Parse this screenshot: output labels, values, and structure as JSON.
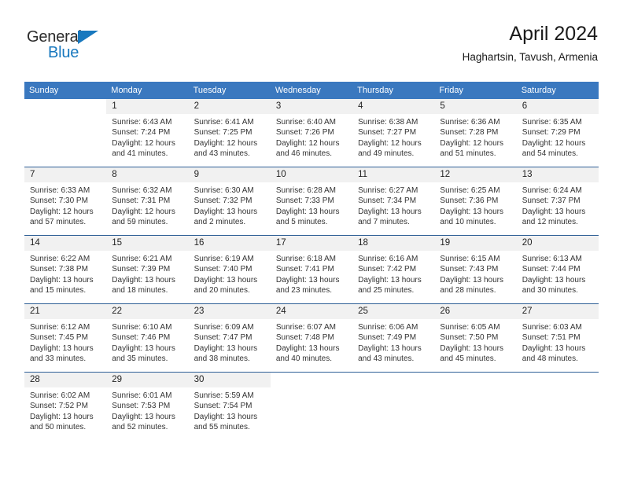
{
  "brand": {
    "name_top": "General",
    "name_bottom": "Blue",
    "flag_color": "#1878be"
  },
  "header": {
    "title": "April 2024",
    "subtitle": "Haghartsin, Tavush, Armenia"
  },
  "theme": {
    "header_row_bg": "#3a78bf",
    "header_row_text": "#ffffff",
    "daynum_bg": "#f1f1f1",
    "row_divider": "#2e5f96"
  },
  "columns": [
    "Sunday",
    "Monday",
    "Tuesday",
    "Wednesday",
    "Thursday",
    "Friday",
    "Saturday"
  ],
  "weeks": [
    [
      {
        "day": "",
        "sunrise": "",
        "sunset": "",
        "daylight_line1": "",
        "daylight_line2": ""
      },
      {
        "day": "1",
        "sunrise": "Sunrise: 6:43 AM",
        "sunset": "Sunset: 7:24 PM",
        "daylight_line1": "Daylight: 12 hours",
        "daylight_line2": "and 41 minutes."
      },
      {
        "day": "2",
        "sunrise": "Sunrise: 6:41 AM",
        "sunset": "Sunset: 7:25 PM",
        "daylight_line1": "Daylight: 12 hours",
        "daylight_line2": "and 43 minutes."
      },
      {
        "day": "3",
        "sunrise": "Sunrise: 6:40 AM",
        "sunset": "Sunset: 7:26 PM",
        "daylight_line1": "Daylight: 12 hours",
        "daylight_line2": "and 46 minutes."
      },
      {
        "day": "4",
        "sunrise": "Sunrise: 6:38 AM",
        "sunset": "Sunset: 7:27 PM",
        "daylight_line1": "Daylight: 12 hours",
        "daylight_line2": "and 49 minutes."
      },
      {
        "day": "5",
        "sunrise": "Sunrise: 6:36 AM",
        "sunset": "Sunset: 7:28 PM",
        "daylight_line1": "Daylight: 12 hours",
        "daylight_line2": "and 51 minutes."
      },
      {
        "day": "6",
        "sunrise": "Sunrise: 6:35 AM",
        "sunset": "Sunset: 7:29 PM",
        "daylight_line1": "Daylight: 12 hours",
        "daylight_line2": "and 54 minutes."
      }
    ],
    [
      {
        "day": "7",
        "sunrise": "Sunrise: 6:33 AM",
        "sunset": "Sunset: 7:30 PM",
        "daylight_line1": "Daylight: 12 hours",
        "daylight_line2": "and 57 minutes."
      },
      {
        "day": "8",
        "sunrise": "Sunrise: 6:32 AM",
        "sunset": "Sunset: 7:31 PM",
        "daylight_line1": "Daylight: 12 hours",
        "daylight_line2": "and 59 minutes."
      },
      {
        "day": "9",
        "sunrise": "Sunrise: 6:30 AM",
        "sunset": "Sunset: 7:32 PM",
        "daylight_line1": "Daylight: 13 hours",
        "daylight_line2": "and 2 minutes."
      },
      {
        "day": "10",
        "sunrise": "Sunrise: 6:28 AM",
        "sunset": "Sunset: 7:33 PM",
        "daylight_line1": "Daylight: 13 hours",
        "daylight_line2": "and 5 minutes."
      },
      {
        "day": "11",
        "sunrise": "Sunrise: 6:27 AM",
        "sunset": "Sunset: 7:34 PM",
        "daylight_line1": "Daylight: 13 hours",
        "daylight_line2": "and 7 minutes."
      },
      {
        "day": "12",
        "sunrise": "Sunrise: 6:25 AM",
        "sunset": "Sunset: 7:36 PM",
        "daylight_line1": "Daylight: 13 hours",
        "daylight_line2": "and 10 minutes."
      },
      {
        "day": "13",
        "sunrise": "Sunrise: 6:24 AM",
        "sunset": "Sunset: 7:37 PM",
        "daylight_line1": "Daylight: 13 hours",
        "daylight_line2": "and 12 minutes."
      }
    ],
    [
      {
        "day": "14",
        "sunrise": "Sunrise: 6:22 AM",
        "sunset": "Sunset: 7:38 PM",
        "daylight_line1": "Daylight: 13 hours",
        "daylight_line2": "and 15 minutes."
      },
      {
        "day": "15",
        "sunrise": "Sunrise: 6:21 AM",
        "sunset": "Sunset: 7:39 PM",
        "daylight_line1": "Daylight: 13 hours",
        "daylight_line2": "and 18 minutes."
      },
      {
        "day": "16",
        "sunrise": "Sunrise: 6:19 AM",
        "sunset": "Sunset: 7:40 PM",
        "daylight_line1": "Daylight: 13 hours",
        "daylight_line2": "and 20 minutes."
      },
      {
        "day": "17",
        "sunrise": "Sunrise: 6:18 AM",
        "sunset": "Sunset: 7:41 PM",
        "daylight_line1": "Daylight: 13 hours",
        "daylight_line2": "and 23 minutes."
      },
      {
        "day": "18",
        "sunrise": "Sunrise: 6:16 AM",
        "sunset": "Sunset: 7:42 PM",
        "daylight_line1": "Daylight: 13 hours",
        "daylight_line2": "and 25 minutes."
      },
      {
        "day": "19",
        "sunrise": "Sunrise: 6:15 AM",
        "sunset": "Sunset: 7:43 PM",
        "daylight_line1": "Daylight: 13 hours",
        "daylight_line2": "and 28 minutes."
      },
      {
        "day": "20",
        "sunrise": "Sunrise: 6:13 AM",
        "sunset": "Sunset: 7:44 PM",
        "daylight_line1": "Daylight: 13 hours",
        "daylight_line2": "and 30 minutes."
      }
    ],
    [
      {
        "day": "21",
        "sunrise": "Sunrise: 6:12 AM",
        "sunset": "Sunset: 7:45 PM",
        "daylight_line1": "Daylight: 13 hours",
        "daylight_line2": "and 33 minutes."
      },
      {
        "day": "22",
        "sunrise": "Sunrise: 6:10 AM",
        "sunset": "Sunset: 7:46 PM",
        "daylight_line1": "Daylight: 13 hours",
        "daylight_line2": "and 35 minutes."
      },
      {
        "day": "23",
        "sunrise": "Sunrise: 6:09 AM",
        "sunset": "Sunset: 7:47 PM",
        "daylight_line1": "Daylight: 13 hours",
        "daylight_line2": "and 38 minutes."
      },
      {
        "day": "24",
        "sunrise": "Sunrise: 6:07 AM",
        "sunset": "Sunset: 7:48 PM",
        "daylight_line1": "Daylight: 13 hours",
        "daylight_line2": "and 40 minutes."
      },
      {
        "day": "25",
        "sunrise": "Sunrise: 6:06 AM",
        "sunset": "Sunset: 7:49 PM",
        "daylight_line1": "Daylight: 13 hours",
        "daylight_line2": "and 43 minutes."
      },
      {
        "day": "26",
        "sunrise": "Sunrise: 6:05 AM",
        "sunset": "Sunset: 7:50 PM",
        "daylight_line1": "Daylight: 13 hours",
        "daylight_line2": "and 45 minutes."
      },
      {
        "day": "27",
        "sunrise": "Sunrise: 6:03 AM",
        "sunset": "Sunset: 7:51 PM",
        "daylight_line1": "Daylight: 13 hours",
        "daylight_line2": "and 48 minutes."
      }
    ],
    [
      {
        "day": "28",
        "sunrise": "Sunrise: 6:02 AM",
        "sunset": "Sunset: 7:52 PM",
        "daylight_line1": "Daylight: 13 hours",
        "daylight_line2": "and 50 minutes."
      },
      {
        "day": "29",
        "sunrise": "Sunrise: 6:01 AM",
        "sunset": "Sunset: 7:53 PM",
        "daylight_line1": "Daylight: 13 hours",
        "daylight_line2": "and 52 minutes."
      },
      {
        "day": "30",
        "sunrise": "Sunrise: 5:59 AM",
        "sunset": "Sunset: 7:54 PM",
        "daylight_line1": "Daylight: 13 hours",
        "daylight_line2": "and 55 minutes."
      },
      {
        "day": "",
        "sunrise": "",
        "sunset": "",
        "daylight_line1": "",
        "daylight_line2": ""
      },
      {
        "day": "",
        "sunrise": "",
        "sunset": "",
        "daylight_line1": "",
        "daylight_line2": ""
      },
      {
        "day": "",
        "sunrise": "",
        "sunset": "",
        "daylight_line1": "",
        "daylight_line2": ""
      },
      {
        "day": "",
        "sunrise": "",
        "sunset": "",
        "daylight_line1": "",
        "daylight_line2": ""
      }
    ]
  ]
}
